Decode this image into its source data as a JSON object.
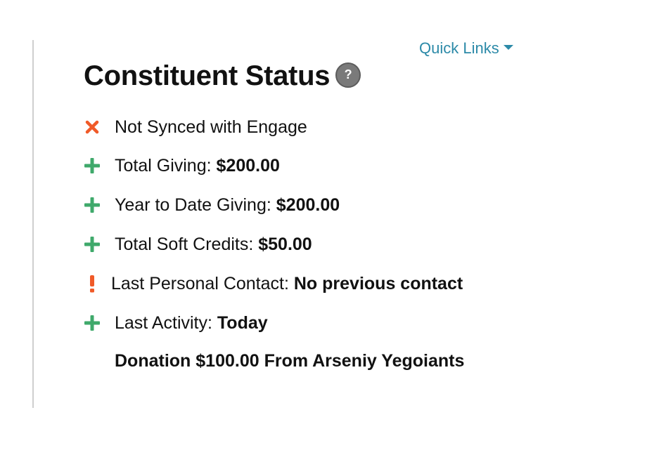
{
  "header": {
    "quick_links_label": "Quick Links",
    "title": "Constituent Status",
    "help_glyph": "?"
  },
  "status_items": [
    {
      "icon": "x-icon",
      "icon_color": "#f05a28",
      "label": "Not Synced with Engage",
      "value": ""
    },
    {
      "icon": "plus-icon",
      "icon_color": "#3fa96b",
      "label": "Total Giving: ",
      "value": "$200.00"
    },
    {
      "icon": "plus-icon",
      "icon_color": "#3fa96b",
      "label": "Year to Date Giving: ",
      "value": "$200.00"
    },
    {
      "icon": "plus-icon",
      "icon_color": "#3fa96b",
      "label": "Total Soft Credits: ",
      "value": "$50.00"
    },
    {
      "icon": "exclamation-icon",
      "icon_color": "#f05a28",
      "label": "Last Personal Contact: ",
      "value": "No previous contact"
    },
    {
      "icon": "plus-icon",
      "icon_color": "#3fa96b",
      "label": "Last Activity: ",
      "value": "Today"
    }
  ],
  "last_activity_detail": "Donation $100.00 From Arseniy Yegoiants"
}
